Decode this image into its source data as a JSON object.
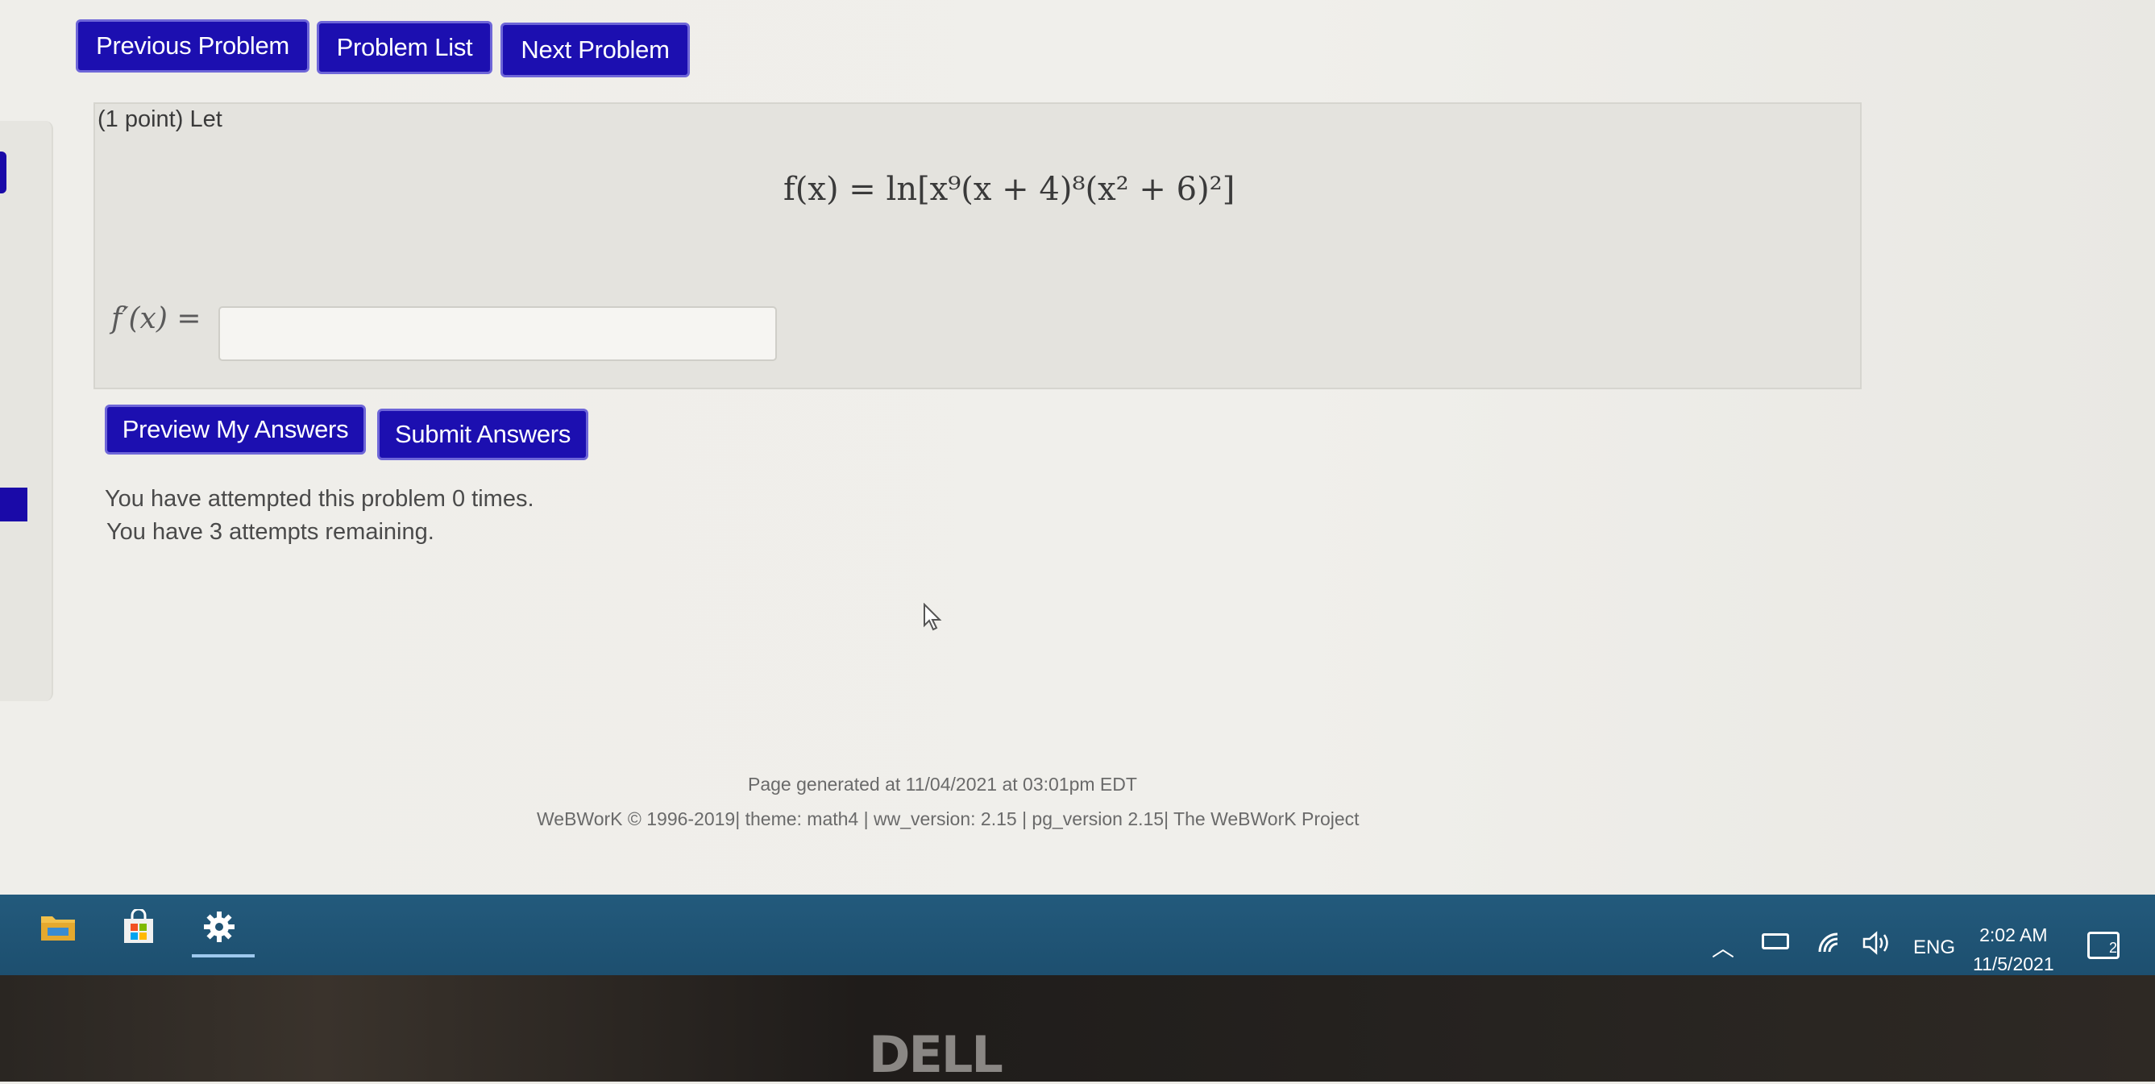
{
  "nav": {
    "previous_label": "Previous Problem",
    "list_label": "Problem List",
    "next_label": "Next Problem"
  },
  "problem": {
    "point_label": "(1 point) Let",
    "formula": "f(x) = ln[x⁹(x + 4)⁸(x² + 6)²]",
    "derivative_label": "f′(x) =",
    "answer_value": ""
  },
  "actions": {
    "preview_label": "Preview My Answers",
    "submit_label": "Submit Answers"
  },
  "status": {
    "attempted": "You have attempted this problem 0 times.",
    "remaining": "You have 3 attempts remaining."
  },
  "footer": {
    "generated": "Page generated at 11/04/2021 at 03:01pm EDT",
    "credits": "WeBWorK © 1996-2019| theme: math4 | ww_version: 2.15 | pg_version 2.15| The WeBWorK Project"
  },
  "taskbar": {
    "icons": [
      "file-explorer-icon",
      "store-icon",
      "settings-icon"
    ],
    "language": "ENG",
    "time": "2:02 AM",
    "date": "11/5/2021",
    "notification_count": "2"
  },
  "bezel": {
    "brand": "DELL"
  },
  "colors": {
    "button_bg": "#1c0fb0",
    "taskbar_bg": "#235a7c"
  }
}
